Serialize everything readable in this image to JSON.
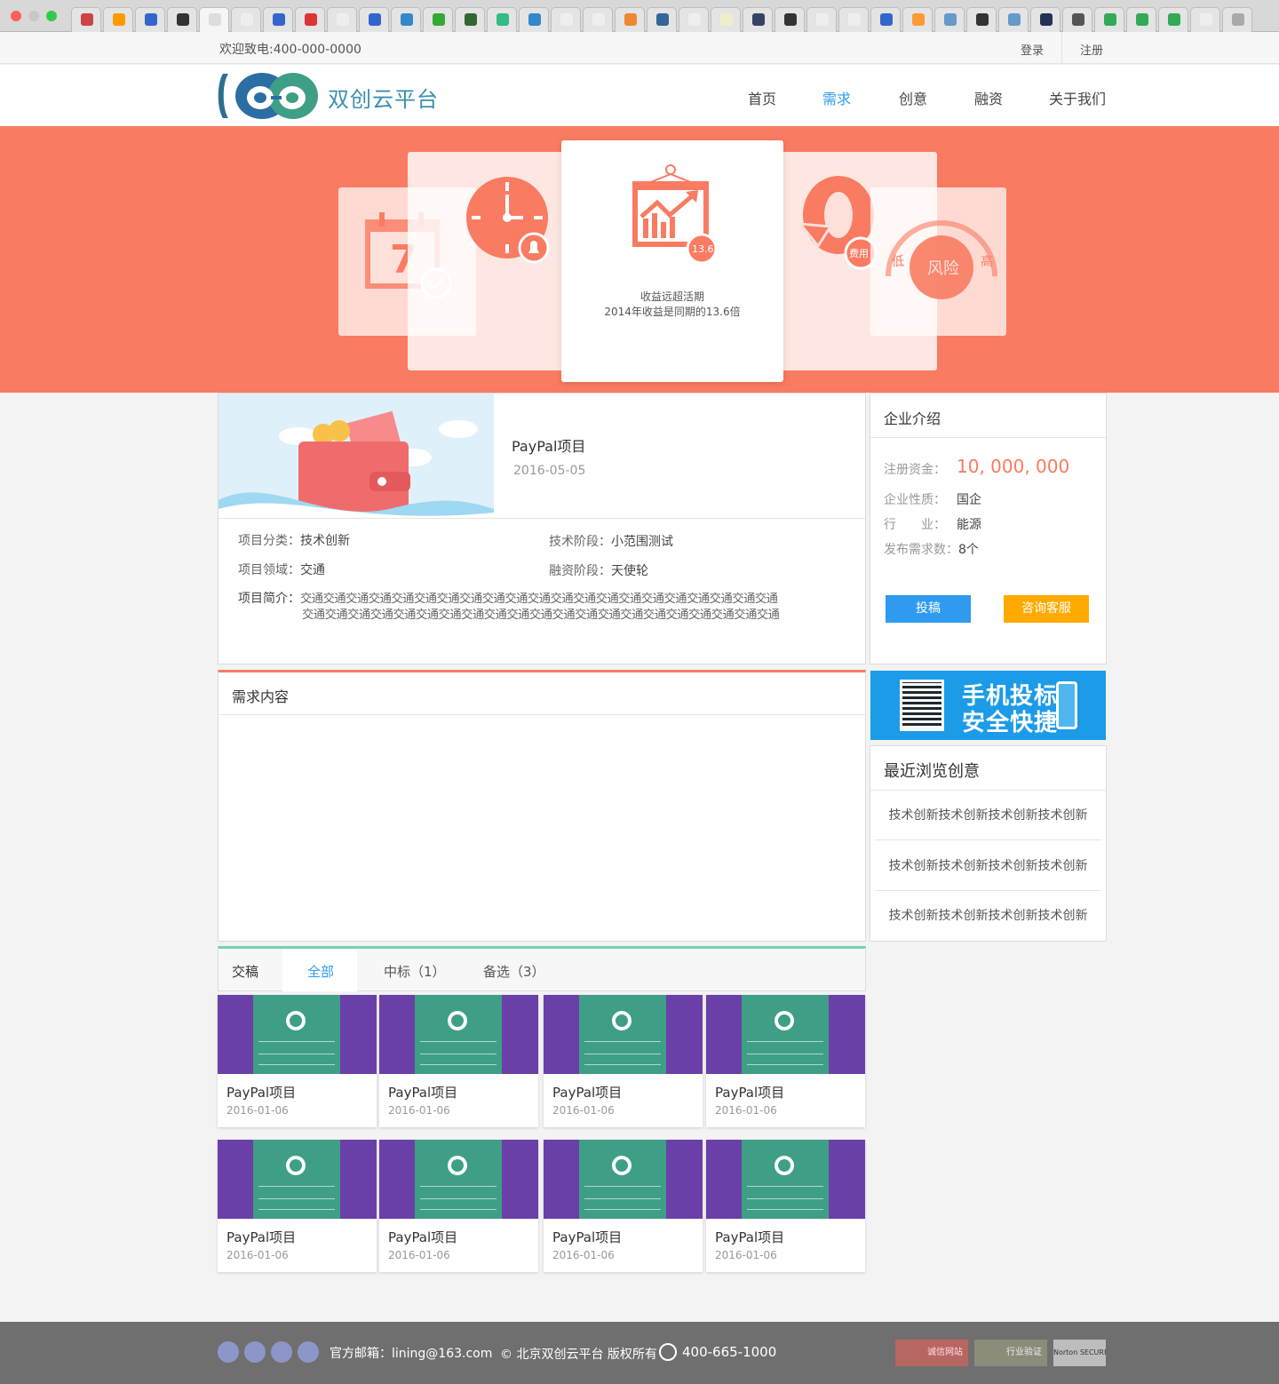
{
  "topbar": {
    "welcome": "欢迎致电:400-000-0000",
    "login": "登录",
    "register": "注册"
  },
  "header": {
    "site_name": "双创云平台",
    "nav": [
      "首页",
      "需求",
      "创意",
      "融资",
      "关于我们"
    ],
    "active_nav": "需求"
  },
  "banner": {
    "center_value": "13.6",
    "center_title": "收益远超活期",
    "center_desc": "2014年收益是同期的13.6倍",
    "calendar_num": "7",
    "fee_badge": "费用",
    "risk_label": "风险",
    "risk_high": "高",
    "risk_low": "低"
  },
  "project": {
    "title": "PayPal项目",
    "date": "2016-05-05",
    "category_label": "项目分类：",
    "category": "技术创新",
    "tech_stage_label": "技术阶段：",
    "tech_stage": "小范围测试",
    "field_label": "项目领域：",
    "field": "交通",
    "funding_stage_label": "融资阶段：",
    "funding_stage": "天使轮",
    "intro_label": "项目简介：",
    "intro_line1": "交通交通交通交通交通交通交通交通交通交通交通交通交通交通交通交通交通交通交通交通交通",
    "intro_line2": "交通交通交通交通交通交通交通交通交通交通交通交通交通交通交通交通交通交通交通交通交通"
  },
  "company": {
    "title": "企业介绍",
    "capital_label": "注册资金：",
    "capital": "10, 000, 000",
    "nature_label": "企业性质：",
    "nature": "国企",
    "industry_label": "行　　业：",
    "industry": "能源",
    "demands_label": "发布需求数：",
    "demands": "8个",
    "submit_btn": "投稿",
    "consult_btn": "咨询客服"
  },
  "promo": {
    "line1": "手机投标",
    "line2": "安全快捷"
  },
  "demand": {
    "title": "需求内容"
  },
  "recent": {
    "title": "最近浏览创意",
    "items": [
      "技术创新技术创新技术创新技术创新",
      "技术创新技术创新技术创新技术创新",
      "技术创新技术创新技术创新技术创新"
    ]
  },
  "submissions": {
    "title": "交稿",
    "tabs": [
      "全部",
      "中标（1）",
      "备选（3）"
    ],
    "active_tab": "全部",
    "items": [
      {
        "title": "PayPal项目",
        "date": "2016-01-06"
      },
      {
        "title": "PayPal项目",
        "date": "2016-01-06"
      },
      {
        "title": "PayPal项目",
        "date": "2016-01-06"
      },
      {
        "title": "PayPal项目",
        "date": "2016-01-06"
      },
      {
        "title": "PayPal项目",
        "date": "2016-01-06"
      },
      {
        "title": "PayPal项目",
        "date": "2016-01-06"
      },
      {
        "title": "PayPal项目",
        "date": "2016-01-06"
      },
      {
        "title": "PayPal项目",
        "date": "2016-01-06"
      }
    ]
  },
  "footer": {
    "email": "官方邮箱：lining@163.com",
    "copyright": "© 北京双创云平台 版权所有",
    "phone": "400-665-1000",
    "badges": [
      "诚信网站",
      "行业验证",
      "Norton SECURED"
    ]
  },
  "colors": {
    "banner": "#f97b62",
    "accent": "#2f9bf0",
    "orange": "#ffaa00",
    "capital": "#f97b62",
    "teal": "#3e9f86",
    "purple": "#6b3fa8"
  }
}
